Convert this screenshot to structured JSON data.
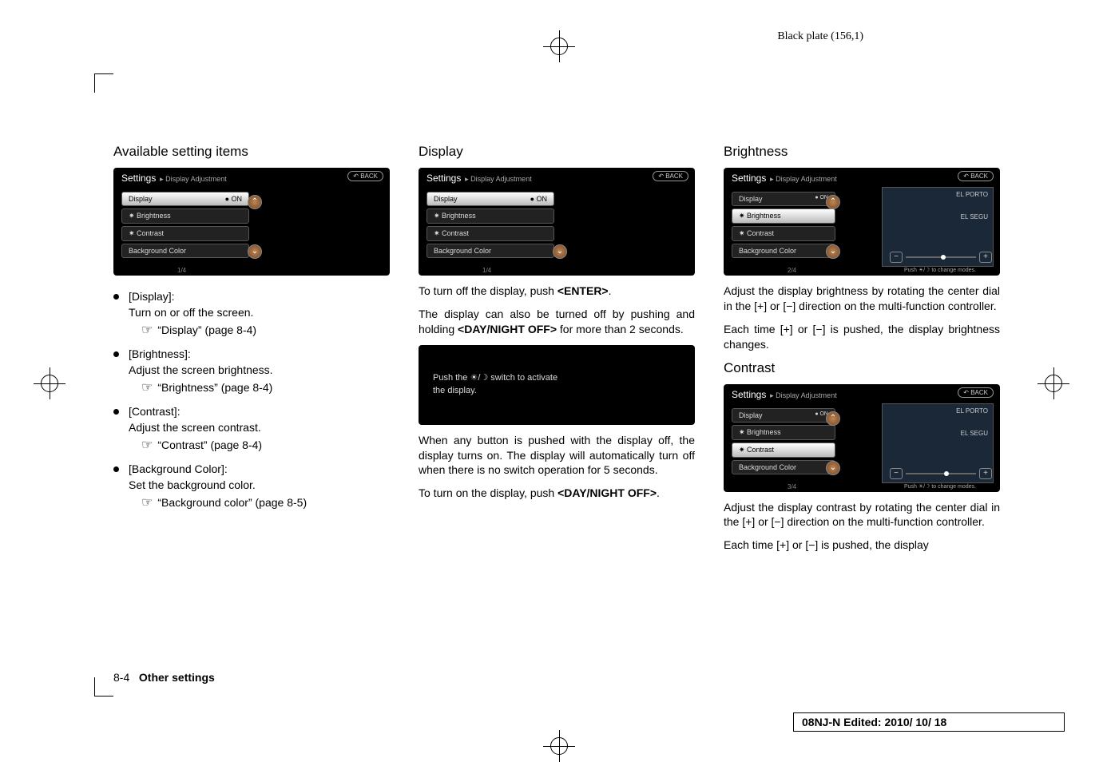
{
  "plate_label": "Black plate (156,1)",
  "col1": {
    "heading": "Available setting items",
    "screenshot": {
      "title": "Settings",
      "breadcrumb": "▸ Display Adjustment",
      "back": "↶ BACK",
      "items": [
        {
          "label": "Display",
          "badge": "● ON",
          "selected": true
        },
        {
          "label": "✷ Brightness",
          "badge": "",
          "selected": false
        },
        {
          "label": "✷ Contrast",
          "badge": "",
          "selected": false
        },
        {
          "label": "Background Color",
          "badge": "",
          "selected": false
        }
      ],
      "page": "1/4"
    },
    "bullets": [
      {
        "title": "[Display]:",
        "desc": "Turn on or off the screen.",
        "ref": "“Display” (page 8-4)"
      },
      {
        "title": "[Brightness]:",
        "desc": "Adjust the screen brightness.",
        "ref": "“Brightness” (page 8-4)"
      },
      {
        "title": "[Contrast]:",
        "desc": "Adjust the screen contrast.",
        "ref": "“Contrast” (page 8-4)"
      },
      {
        "title": "[Background Color]:",
        "desc": "Set the background color.",
        "ref": "“Background color” (page 8-5)"
      }
    ]
  },
  "col2": {
    "heading": "Display",
    "screenshot": {
      "title": "Settings",
      "breadcrumb": "▸ Display Adjustment",
      "back": "↶ BACK",
      "items": [
        {
          "label": "Display",
          "badge": "● ON",
          "selected": true
        },
        {
          "label": "✷ Brightness",
          "badge": "",
          "selected": false
        },
        {
          "label": "✷ Contrast",
          "badge": "",
          "selected": false
        },
        {
          "label": "Background Color",
          "badge": "",
          "selected": false
        }
      ],
      "page": "1/4"
    },
    "p1_a": "To turn off the display, push ",
    "p1_b": "<ENTER>",
    "p1_c": ".",
    "p2_a": "The display can also be turned off by pushing and holding ",
    "p2_b": "<DAY/NIGHT OFF>",
    "p2_c": " for more than 2 seconds.",
    "activate_a": "Push the ☀/☽ switch to activate",
    "activate_b": "the display.",
    "p3": "When any button is pushed with the display off, the display turns on. The display will automatically turn off when there is no switch operation for 5 seconds.",
    "p4_a": "To turn on the display, push ",
    "p4_b": "<DAY/NIGHT OFF>",
    "p4_c": "."
  },
  "col3": {
    "heading_b": "Brightness",
    "screenshot_b": {
      "title": "Settings",
      "breadcrumb": "▸ Display Adjustment",
      "back": "↶ BACK",
      "items": [
        {
          "label": "Display",
          "badge": "● ON",
          "selected": false
        },
        {
          "label": "✷ Brightness",
          "badge": "",
          "selected": true
        },
        {
          "label": "✷ Contrast",
          "badge": "",
          "selected": false
        },
        {
          "label": "Background Color",
          "badge": "",
          "selected": false
        }
      ],
      "page": "2/4",
      "preview": "EL PORTO",
      "preview_sub": "EL SEGU",
      "slider_minus": "−",
      "slider_plus": "+",
      "note": "Push ☀/☽ to change modes."
    },
    "b_p1": "Adjust the display brightness by rotating the center dial in the [+] or [−] direction on the multi-function controller.",
    "b_p2": "Each time [+] or [−] is pushed, the display brightness changes.",
    "heading_c": "Contrast",
    "screenshot_c": {
      "title": "Settings",
      "breadcrumb": "▸ Display Adjustment",
      "back": "↶ BACK",
      "items": [
        {
          "label": "Display",
          "badge": "● ON",
          "selected": false
        },
        {
          "label": "✷ Brightness",
          "badge": "",
          "selected": false
        },
        {
          "label": "✷ Contrast",
          "badge": "",
          "selected": true
        },
        {
          "label": "Background Color",
          "badge": "",
          "selected": false
        }
      ],
      "page": "3/4",
      "preview": "EL PORTO",
      "preview_sub": "EL SEGU",
      "slider_minus": "−",
      "slider_plus": "+",
      "note": "Push ☀/☽ to change modes."
    },
    "c_p1": "Adjust the display contrast by rotating the center dial in the [+] or [−] direction on the multi-function controller.",
    "c_p2": "Each time [+] or [−] is pushed, the display"
  },
  "footer": {
    "page_num": "8-4",
    "section": "Other settings",
    "box": "08NJ-N Edited: 2010/ 10/ 18"
  }
}
